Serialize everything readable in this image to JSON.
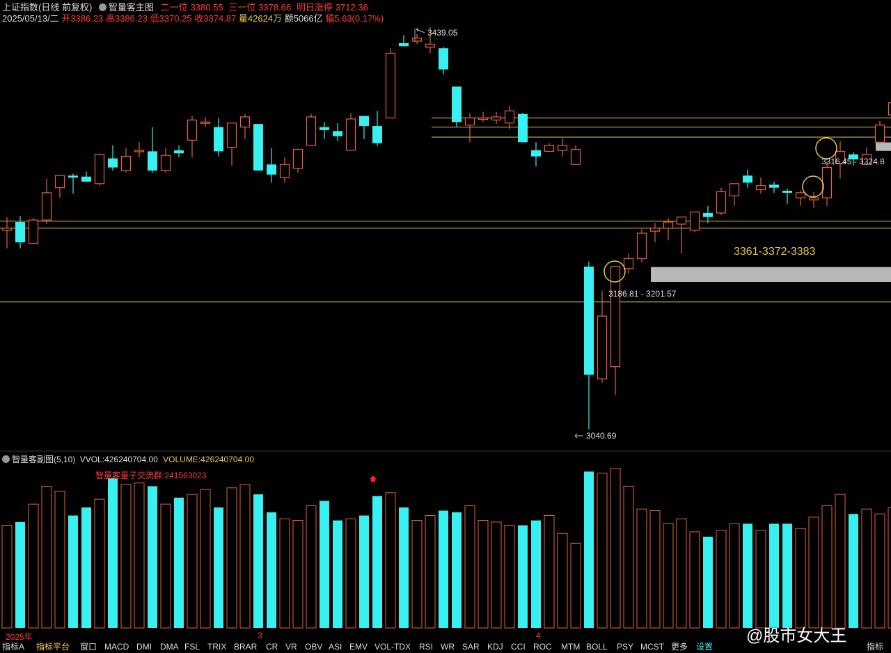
{
  "header": {
    "title": "上证指数(日线 前复权)",
    "main_chart_label": "智量客主图",
    "level2_label": "二一位",
    "level2_value": "3380.55",
    "level3_label": "三一位",
    "level3_value": "3378.66",
    "limit_label": "明日涨停",
    "limit_value": "3712.36",
    "date": "2025/05/13/二",
    "open_label": "开",
    "open": "3386.23",
    "high_label": "高",
    "high": "3386.23",
    "low_label": "低",
    "low": "3370.25",
    "close_label": "收",
    "close": "3374.87",
    "vol_label": "量",
    "vol": "42624万",
    "amt_label": "额",
    "amt": "5066亿",
    "amp_label": "幅",
    "amp": "5.63(0.17%)"
  },
  "sub": {
    "title": "智量客副图(5,10)",
    "vvol_label": "VVOL:",
    "vvol": "426240704.00",
    "volume_label": "VOLUME:",
    "volume": "426240704.00",
    "flow_label": "智量客量子交流群:",
    "flow_value": "241563023"
  },
  "annotations": {
    "high": "3439.05",
    "low": "3040.69",
    "zone_low": "3186.81 - 3201.57",
    "zone_high": "3316.45 - 3324.8",
    "targets": "3361-3372-3383"
  },
  "axis": {
    "year_label": "2025年",
    "month_3": "3",
    "month_4": "4"
  },
  "tabs": [
    "指标A",
    "指标平台",
    "窗口",
    "MACD",
    "DMI",
    "DMA",
    "FSL",
    "TRIX",
    "BRAR",
    "CR",
    "VR",
    "OBV",
    "ASI",
    "EMV",
    "VOL-TDX",
    "RSI",
    "WR",
    "SAR",
    "KDJ",
    "CCI",
    "ROC",
    "MTM",
    "BOLL",
    "PSY",
    "MCST",
    "更多",
    "设置",
    "指标"
  ],
  "watermark": "@股市女大王",
  "colors": {
    "up": "#e8603c",
    "down": "#38f0f0",
    "line": "#e6c84c",
    "zone": "#b8b8b8"
  },
  "chart_data": {
    "type": "candlestick",
    "price_range": [
      3025,
      3445
    ],
    "volume_range": [
      0,
      10
    ],
    "horizontal_lines": [
      3349,
      3340,
      3330,
      3247,
      3240,
      3167
    ],
    "zones": [
      {
        "from": 3186.81,
        "to": 3201.57,
        "start_index": 49
      },
      {
        "from": 3316.45,
        "to": 3324.8,
        "start_index": 66
      }
    ],
    "candles": [
      {
        "o": 3238,
        "h": 3251,
        "l": 3220,
        "c": 3240,
        "v": 6.3
      },
      {
        "o": 3246,
        "h": 3252,
        "l": 3220,
        "c": 3226,
        "v": 6.5
      },
      {
        "o": 3225,
        "h": 3250,
        "l": 3225,
        "c": 3248,
        "v": 7.6
      },
      {
        "o": 3248,
        "h": 3289,
        "l": 3244,
        "c": 3275,
        "v": 8.7
      },
      {
        "o": 3280,
        "h": 3292,
        "l": 3270,
        "c": 3292,
        "v": 8.4
      },
      {
        "o": 3292,
        "h": 3294,
        "l": 3274,
        "c": 3290,
        "v": 6.9
      },
      {
        "o": 3291,
        "h": 3296,
        "l": 3286,
        "c": 3286,
        "v": 7.4
      },
      {
        "o": 3284,
        "h": 3314,
        "l": 3282,
        "c": 3313,
        "v": 7.9
      },
      {
        "o": 3309,
        "h": 3322,
        "l": 3297,
        "c": 3300,
        "v": 9.2
      },
      {
        "o": 3297,
        "h": 3319,
        "l": 3295,
        "c": 3311,
        "v": 8.8
      },
      {
        "o": 3317,
        "h": 3325,
        "l": 3310,
        "c": 3317,
        "v": 8.9
      },
      {
        "o": 3316,
        "h": 3340,
        "l": 3295,
        "c": 3297,
        "v": 8.7
      },
      {
        "o": 3297,
        "h": 3319,
        "l": 3295,
        "c": 3312,
        "v": 7.6
      },
      {
        "o": 3317,
        "h": 3322,
        "l": 3310,
        "c": 3314,
        "v": 8.0
      },
      {
        "o": 3327,
        "h": 3351,
        "l": 3310,
        "c": 3347,
        "v": 8.2
      },
      {
        "o": 3345,
        "h": 3350,
        "l": 3340,
        "c": 3345,
        "v": 8.5
      },
      {
        "o": 3340,
        "h": 3349,
        "l": 3311,
        "c": 3316,
        "v": 7.4
      },
      {
        "o": 3320,
        "h": 3334,
        "l": 3302,
        "c": 3344,
        "v": 8.6
      },
      {
        "o": 3340,
        "h": 3353,
        "l": 3328,
        "c": 3350,
        "v": 8.8
      },
      {
        "o": 3343,
        "h": 3343,
        "l": 3297,
        "c": 3297,
        "v": 8.2
      },
      {
        "o": 3303,
        "h": 3319,
        "l": 3285,
        "c": 3293,
        "v": 7.1
      },
      {
        "o": 3290,
        "h": 3310,
        "l": 3285,
        "c": 3303,
        "v": 6.7
      },
      {
        "o": 3299,
        "h": 3318,
        "l": 3295,
        "c": 3318,
        "v": 6.6
      },
      {
        "o": 3322,
        "h": 3353,
        "l": 3322,
        "c": 3350,
        "v": 7.5
      },
      {
        "o": 3340,
        "h": 3345,
        "l": 3328,
        "c": 3337,
        "v": 7.8
      },
      {
        "o": 3336,
        "h": 3344,
        "l": 3326,
        "c": 3331,
        "v": 6.6
      },
      {
        "o": 3317,
        "h": 3354,
        "l": 3317,
        "c": 3348,
        "v": 6.7
      },
      {
        "o": 3351,
        "h": 3351,
        "l": 3328,
        "c": 3341,
        "v": 6.9
      },
      {
        "o": 3341,
        "h": 3356,
        "l": 3321,
        "c": 3324,
        "v": 8.1
      },
      {
        "o": 3349,
        "h": 3418,
        "l": 3349,
        "c": 3413,
        "v": 8.3
      },
      {
        "o": 3423,
        "h": 3431,
        "l": 3420,
        "c": 3420,
        "v": 7.4
      },
      {
        "o": 3425,
        "h": 3432,
        "l": 3422,
        "c": 3428,
        "v": 6.6
      },
      {
        "o": 3419,
        "h": 3439,
        "l": 3413,
        "c": 3422,
        "v": 6.9
      },
      {
        "o": 3418,
        "h": 3419,
        "l": 3392,
        "c": 3397,
        "v": 7.2
      },
      {
        "o": 3380,
        "h": 3380,
        "l": 3340,
        "c": 3345,
        "v": 7.1
      },
      {
        "o": 3342,
        "h": 3354,
        "l": 3325,
        "c": 3349,
        "v": 7.5
      },
      {
        "o": 3349,
        "h": 3355,
        "l": 3345,
        "c": 3349,
        "v": 6.6
      },
      {
        "o": 3347,
        "h": 3355,
        "l": 3343,
        "c": 3350,
        "v": 6.5
      },
      {
        "o": 3344,
        "h": 3361,
        "l": 3338,
        "c": 3356,
        "v": 6.3
      },
      {
        "o": 3353,
        "h": 3354,
        "l": 3325,
        "c": 3325,
        "v": 6.3
      },
      {
        "o": 3317,
        "h": 3325,
        "l": 3301,
        "c": 3311,
        "v": 6.6
      },
      {
        "o": 3316,
        "h": 3324,
        "l": 3316,
        "c": 3322,
        "v": 6.9
      },
      {
        "o": 3317,
        "h": 3329,
        "l": 3311,
        "c": 3322,
        "v": 5.8
      },
      {
        "o": 3303,
        "h": 3322,
        "l": 3303,
        "c": 3318,
        "v": 5.2
      },
      {
        "o": 3202,
        "h": 3207,
        "l": 3041,
        "c": 3095,
        "v": 9.6
      },
      {
        "o": 3091,
        "h": 3178,
        "l": 3087,
        "c": 3153,
        "v": 9.5
      },
      {
        "o": 3103,
        "h": 3201,
        "l": 3075,
        "c": 3202,
        "v": 9.8
      },
      {
        "o": 3200,
        "h": 3215,
        "l": 3195,
        "c": 3210,
        "v": 8.7
      },
      {
        "o": 3210,
        "h": 3239,
        "l": 3206,
        "c": 3235,
        "v": 7.3
      },
      {
        "o": 3237,
        "h": 3245,
        "l": 3226,
        "c": 3240,
        "v": 7.2
      },
      {
        "o": 3240,
        "h": 3250,
        "l": 3228,
        "c": 3246,
        "v": 6.4
      },
      {
        "o": 3244,
        "h": 3251,
        "l": 3215,
        "c": 3251,
        "v": 6.7
      },
      {
        "o": 3238,
        "h": 3256,
        "l": 3236,
        "c": 3256,
        "v": 5.9
      },
      {
        "o": 3255,
        "h": 3262,
        "l": 3245,
        "c": 3251,
        "v": 5.6
      },
      {
        "o": 3255,
        "h": 3280,
        "l": 3253,
        "c": 3276,
        "v": 6.0
      },
      {
        "o": 3272,
        "h": 3284,
        "l": 3262,
        "c": 3284,
        "v": 6.4
      },
      {
        "o": 3292,
        "h": 3298,
        "l": 3280,
        "c": 3285,
        "v": 6.4
      },
      {
        "o": 3278,
        "h": 3290,
        "l": 3274,
        "c": 3282,
        "v": 6.0
      },
      {
        "o": 3283,
        "h": 3286,
        "l": 3275,
        "c": 3280,
        "v": 6.4
      },
      {
        "o": 3277,
        "h": 3279,
        "l": 3264,
        "c": 3275,
        "v": 6.4
      },
      {
        "o": 3270,
        "h": 3277,
        "l": 3262,
        "c": 3275,
        "v": 6.1
      },
      {
        "o": 3268,
        "h": 3276,
        "l": 3260,
        "c": 3270,
        "v": 6.8
      },
      {
        "o": 3270,
        "h": 3306,
        "l": 3262,
        "c": 3300,
        "v": 7.5
      },
      {
        "o": 3304,
        "h": 3326,
        "l": 3289,
        "c": 3316,
        "v": 8.2
      },
      {
        "o": 3313,
        "h": 3315,
        "l": 3302,
        "c": 3308,
        "v": 7.0
      },
      {
        "o": 3303,
        "h": 3320,
        "l": 3303,
        "c": 3313,
        "v": 7.3
      },
      {
        "o": 3325,
        "h": 3346,
        "l": 3323,
        "c": 3342,
        "v": 7.0
      },
      {
        "o": 3352,
        "h": 3359,
        "l": 3348,
        "c": 3364,
        "v": 7.4
      }
    ]
  }
}
